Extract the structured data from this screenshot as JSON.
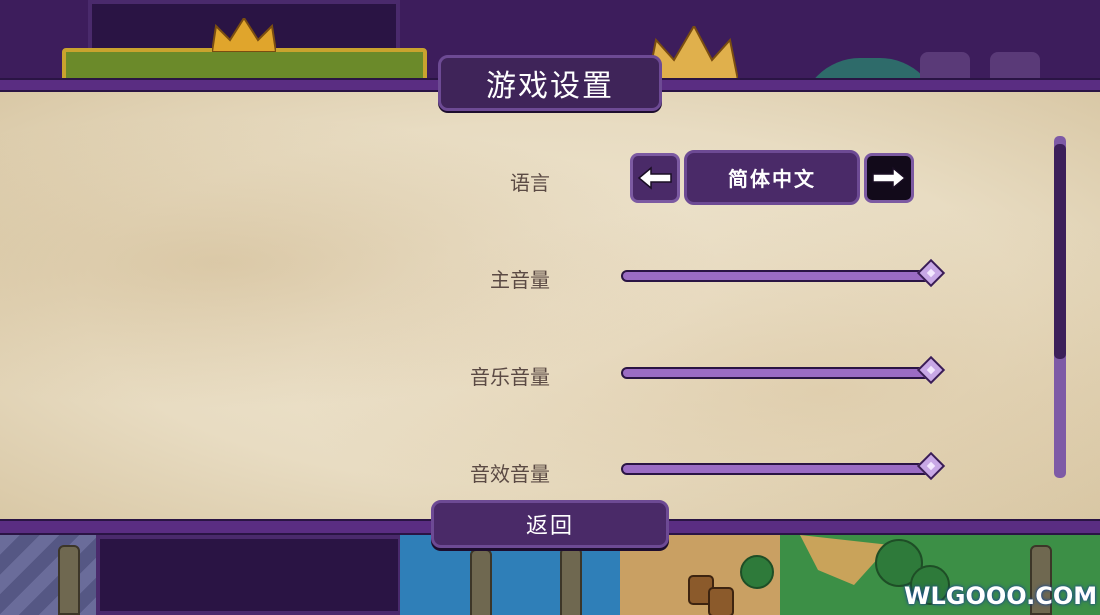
{
  "title": "游戏设置",
  "settings": {
    "language": {
      "label": "语言",
      "value": "简体中文",
      "prev_icon": "arrow-left-icon",
      "next_icon": "arrow-right-icon"
    },
    "master_volume": {
      "label": "主音量",
      "level": 1.0
    },
    "music_volume": {
      "label": "音乐音量",
      "level": 1.0
    },
    "sfx_volume": {
      "label": "音效音量",
      "level": 1.0
    }
  },
  "back_button": {
    "label": "返回"
  },
  "scrollbar": {
    "position": 0.0
  },
  "watermark": {
    "text": "WLGOOO.COM",
    "icon": "gamepad-icon"
  },
  "colors": {
    "frame_purple": "#5a2d82",
    "button_purple": "#4a2a68",
    "parchment": "#e8dcc2",
    "slider_fill": "#9b6cc4",
    "label_text": "#5b4a44"
  }
}
